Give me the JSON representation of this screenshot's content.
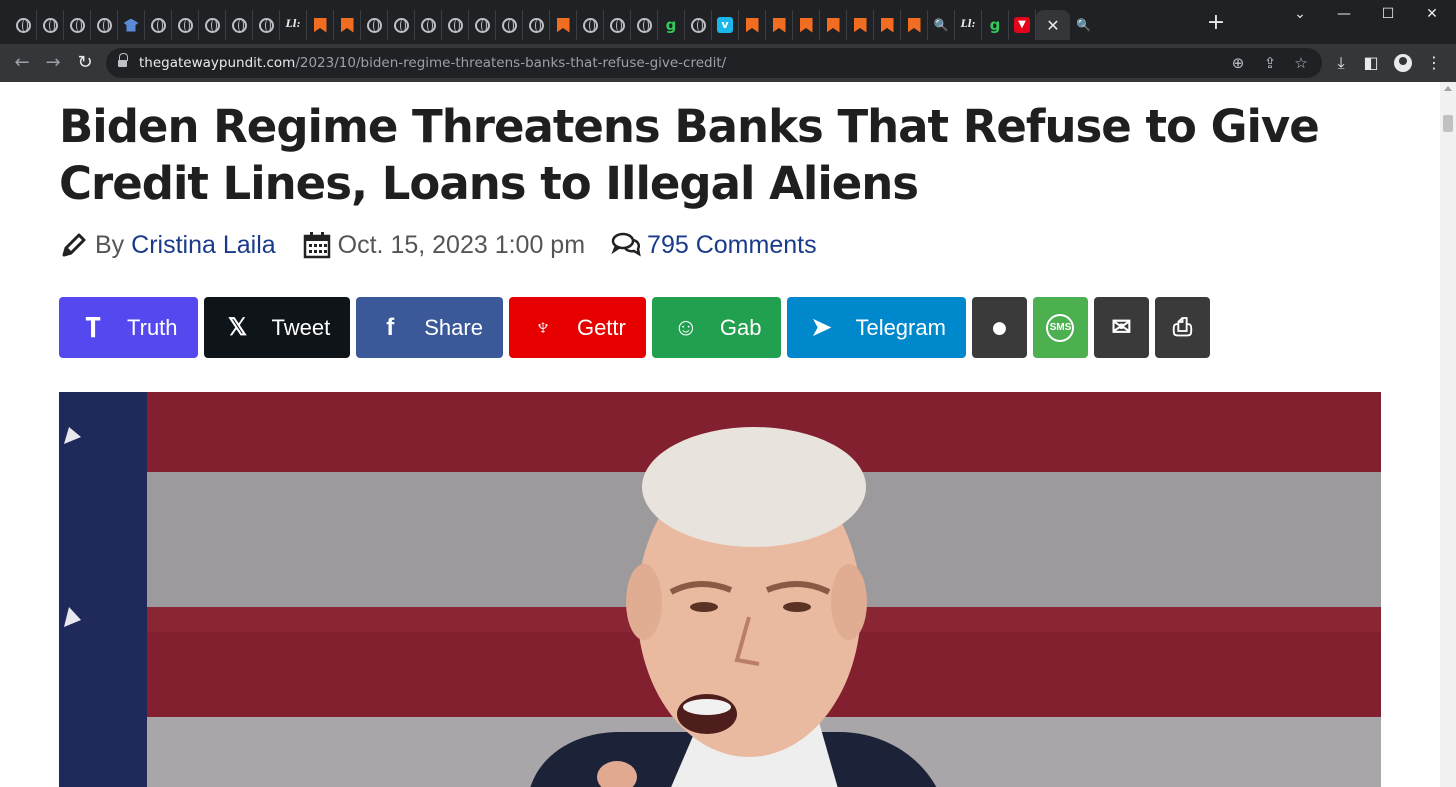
{
  "browser": {
    "active_tab_close": "✕",
    "new_tab": "+",
    "window_controls": {
      "dropdown": "⌄",
      "minimize": "—",
      "maximize": "☐",
      "close": "✕"
    },
    "tabs": [
      {
        "icon": "globe-icon"
      },
      {
        "icon": "globe-icon"
      },
      {
        "icon": "globe-icon"
      },
      {
        "icon": "globe-icon"
      },
      {
        "icon": "graduation-cap-icon"
      },
      {
        "icon": "globe-icon"
      },
      {
        "icon": "globe-icon"
      },
      {
        "icon": "globe-icon"
      },
      {
        "icon": "globe-icon"
      },
      {
        "icon": "globe-icon"
      },
      {
        "icon": "text-logo-icon",
        "glyph": "Ll:"
      },
      {
        "icon": "bookmark-icon"
      },
      {
        "icon": "bookmark-icon"
      },
      {
        "icon": "globe-icon"
      },
      {
        "icon": "globe-icon"
      },
      {
        "icon": "globe-icon"
      },
      {
        "icon": "globe-icon"
      },
      {
        "icon": "globe-icon"
      },
      {
        "icon": "globe-icon"
      },
      {
        "icon": "globe-icon"
      },
      {
        "icon": "bookmark-icon"
      },
      {
        "icon": "globe-icon"
      },
      {
        "icon": "globe-icon"
      },
      {
        "icon": "globe-icon"
      },
      {
        "icon": "g-logo-icon",
        "glyph": "g"
      },
      {
        "icon": "globe-icon"
      },
      {
        "icon": "vimeo-icon",
        "glyph": "v"
      },
      {
        "icon": "bookmark-icon"
      },
      {
        "icon": "bookmark-icon"
      },
      {
        "icon": "bookmark-icon"
      },
      {
        "icon": "bookmark-icon"
      },
      {
        "icon": "bookmark-icon"
      },
      {
        "icon": "bookmark-icon"
      },
      {
        "icon": "bookmark-icon"
      },
      {
        "icon": "search-icon",
        "glyph": "🔍"
      },
      {
        "icon": "text-logo-icon",
        "glyph": "Ll:"
      },
      {
        "icon": "g-logo-icon",
        "glyph": "g"
      },
      {
        "icon": "red-logo-icon",
        "glyph": "▼"
      }
    ],
    "trailing_tab": {
      "icon": "search-icon",
      "glyph": "🔍"
    }
  },
  "address_bar": {
    "host": "thegatewaypundit.com",
    "path": "/2023/10/biden-regime-threatens-banks-that-refuse-give-credit/"
  },
  "article": {
    "headline": "Biden Regime Threatens Banks That Refuse to Give Credit Lines, Loans to Illegal Aliens",
    "by_label": "By",
    "author": "Cristina Laila",
    "date": "Oct. 15, 2023 1:00 pm",
    "comments": "795 Comments"
  },
  "share_buttons": [
    {
      "id": "truth",
      "label": "Truth",
      "icon": "truth-social-icon",
      "glyph": "T",
      "color": "#5448ee"
    },
    {
      "id": "tweet",
      "label": "Tweet",
      "icon": "x-logo-icon",
      "glyph": "𝕏",
      "color": "#0f1419"
    },
    {
      "id": "share",
      "label": "Share",
      "icon": "facebook-icon",
      "glyph": "f",
      "color": "#3b5998"
    },
    {
      "id": "gettr",
      "label": "Gettr",
      "icon": "gettr-torch-icon",
      "glyph": "♆",
      "color": "#e60000"
    },
    {
      "id": "gab",
      "label": "Gab",
      "icon": "gab-frog-icon",
      "glyph": "☺",
      "color": "#21a04f"
    },
    {
      "id": "telegram",
      "label": "Telegram",
      "icon": "telegram-plane-icon",
      "glyph": "➤",
      "color": "#0088cc"
    },
    {
      "id": "comment",
      "label": "",
      "icon": "speech-bubble-icon",
      "glyph": "●",
      "color": "#3a3a3a"
    },
    {
      "id": "sms",
      "label": "",
      "icon": "sms-icon",
      "glyph": "SMS",
      "color": "#4caf50"
    },
    {
      "id": "email",
      "label": "",
      "icon": "envelope-icon",
      "glyph": "✉",
      "color": "#3a3a3a"
    },
    {
      "id": "print",
      "label": "",
      "icon": "printer-icon",
      "glyph": "⎙",
      "color": "#3a3a3a"
    }
  ]
}
